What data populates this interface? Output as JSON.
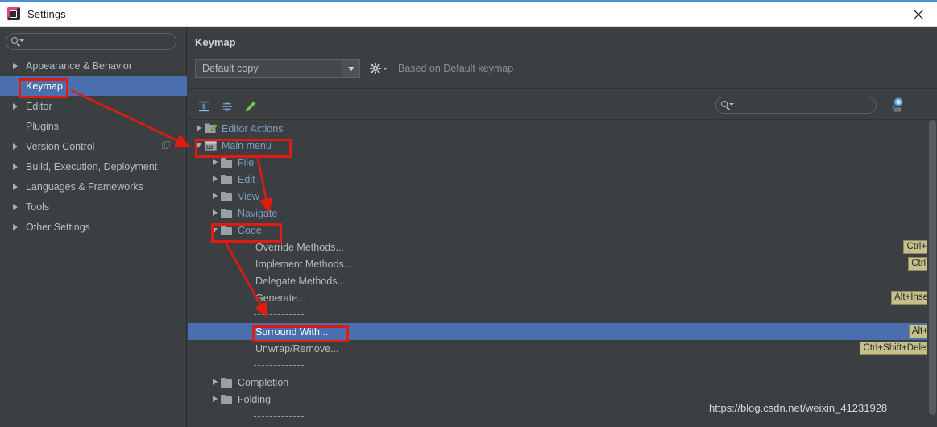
{
  "window": {
    "title": "Settings",
    "app_icon": "intellij-idea-icon",
    "close_label": "✕"
  },
  "sidebar": {
    "search": {
      "placeholder": "",
      "value": "",
      "icon": "search-icon"
    },
    "items": [
      {
        "label": "Appearance & Behavior",
        "expandable": true,
        "selected": false,
        "trailing_icon": ""
      },
      {
        "label": "Keymap",
        "expandable": false,
        "selected": true,
        "trailing_icon": ""
      },
      {
        "label": "Editor",
        "expandable": true,
        "selected": false,
        "trailing_icon": ""
      },
      {
        "label": "Plugins",
        "expandable": false,
        "selected": false,
        "trailing_icon": ""
      },
      {
        "label": "Version Control",
        "expandable": true,
        "selected": false,
        "trailing_icon": "copy-icon"
      },
      {
        "label": "Build, Execution, Deployment",
        "expandable": true,
        "selected": false,
        "trailing_icon": ""
      },
      {
        "label": "Languages & Frameworks",
        "expandable": true,
        "selected": false,
        "trailing_icon": ""
      },
      {
        "label": "Tools",
        "expandable": true,
        "selected": false,
        "trailing_icon": ""
      },
      {
        "label": "Other Settings",
        "expandable": true,
        "selected": false,
        "trailing_icon": ""
      }
    ]
  },
  "panel": {
    "title": "Keymap",
    "keymap_combo": {
      "value": "Default copy",
      "caret_icon": "chevron-down-icon"
    },
    "gear": {
      "icon": "gear-icon",
      "caret_icon": "chevron-down-icon"
    },
    "based_on": "Based on Default keymap",
    "toolbar": [
      {
        "name": "expand-all-button",
        "icon": "expand-all-icon"
      },
      {
        "name": "collapse-all-button",
        "icon": "collapse-all-icon"
      },
      {
        "name": "edit-shortcut-button",
        "icon": "pencil-icon"
      }
    ],
    "tree_search": {
      "placeholder": "",
      "value": "",
      "icon": "search-icon"
    },
    "find_by_shortcut": {
      "icon": "find-by-shortcut-icon"
    }
  },
  "tree": {
    "rows": [
      {
        "label": "Editor Actions",
        "indent": 0,
        "arrow": "closed",
        "icon": "editor-actions-icon",
        "style": "blue",
        "shortcut": "",
        "selected": false,
        "separator": false
      },
      {
        "label": "Main menu",
        "indent": 0,
        "arrow": "open",
        "icon": "main-menu-icon",
        "style": "blue",
        "shortcut": "",
        "selected": false,
        "separator": false
      },
      {
        "label": "File",
        "indent": 1,
        "arrow": "closed",
        "icon": "folder-icon",
        "style": "blue",
        "shortcut": "",
        "selected": false,
        "separator": false
      },
      {
        "label": "Edit",
        "indent": 1,
        "arrow": "closed",
        "icon": "folder-icon",
        "style": "blue",
        "shortcut": "",
        "selected": false,
        "separator": false
      },
      {
        "label": "View",
        "indent": 1,
        "arrow": "closed",
        "icon": "folder-icon",
        "style": "blue",
        "shortcut": "",
        "selected": false,
        "separator": false
      },
      {
        "label": "Navigate",
        "indent": 1,
        "arrow": "closed",
        "icon": "folder-icon",
        "style": "blue",
        "shortcut": "",
        "selected": false,
        "separator": false
      },
      {
        "label": "Code",
        "indent": 1,
        "arrow": "open",
        "icon": "folder-icon",
        "style": "blue",
        "shortcut": "",
        "selected": false,
        "separator": false
      },
      {
        "label": "Override Methods...",
        "indent": 2,
        "arrow": "none",
        "icon": "none",
        "style": "plain",
        "shortcut": "Ctrl+O",
        "selected": false,
        "separator": false
      },
      {
        "label": "Implement Methods...",
        "indent": 2,
        "arrow": "none",
        "icon": "none",
        "style": "plain",
        "shortcut": "Ctrl+I",
        "selected": false,
        "separator": false
      },
      {
        "label": "Delegate Methods...",
        "indent": 2,
        "arrow": "none",
        "icon": "none",
        "style": "plain",
        "shortcut": "",
        "selected": false,
        "separator": false
      },
      {
        "label": "Generate...",
        "indent": 2,
        "arrow": "none",
        "icon": "none",
        "style": "plain",
        "shortcut": "Alt+Insert",
        "selected": false,
        "separator": false
      },
      {
        "label": "",
        "indent": 2,
        "arrow": "none",
        "icon": "none",
        "style": "plain",
        "shortcut": "",
        "selected": false,
        "separator": true
      },
      {
        "label": "Surround With...",
        "indent": 2,
        "arrow": "none",
        "icon": "none",
        "style": "plain",
        "shortcut": "Alt+T",
        "selected": true,
        "separator": false
      },
      {
        "label": "Unwrap/Remove...",
        "indent": 2,
        "arrow": "none",
        "icon": "none",
        "style": "plain",
        "shortcut": "Ctrl+Shift+Delete",
        "selected": false,
        "separator": false
      },
      {
        "label": "",
        "indent": 2,
        "arrow": "none",
        "icon": "none",
        "style": "plain",
        "shortcut": "",
        "selected": false,
        "separator": true
      },
      {
        "label": "Completion",
        "indent": 1,
        "arrow": "closed",
        "icon": "folder-icon",
        "style": "plain",
        "shortcut": "",
        "selected": false,
        "separator": false
      },
      {
        "label": "Folding",
        "indent": 1,
        "arrow": "closed",
        "icon": "folder-icon",
        "style": "plain",
        "shortcut": "",
        "selected": false,
        "separator": false
      },
      {
        "label": "",
        "indent": 2,
        "arrow": "none",
        "icon": "none",
        "style": "plain",
        "shortcut": "",
        "selected": false,
        "separator": true
      }
    ]
  },
  "watermark": "https://blog.csdn.net/weixin_41231928",
  "colors": {
    "background": "#3c3f41",
    "selection": "#4b6eaf",
    "annotation": "#e01b10",
    "shortcut_badge": "#c5c08b",
    "tree_blue_text": "#7a9ec2",
    "titlebar": "#ffffff"
  }
}
